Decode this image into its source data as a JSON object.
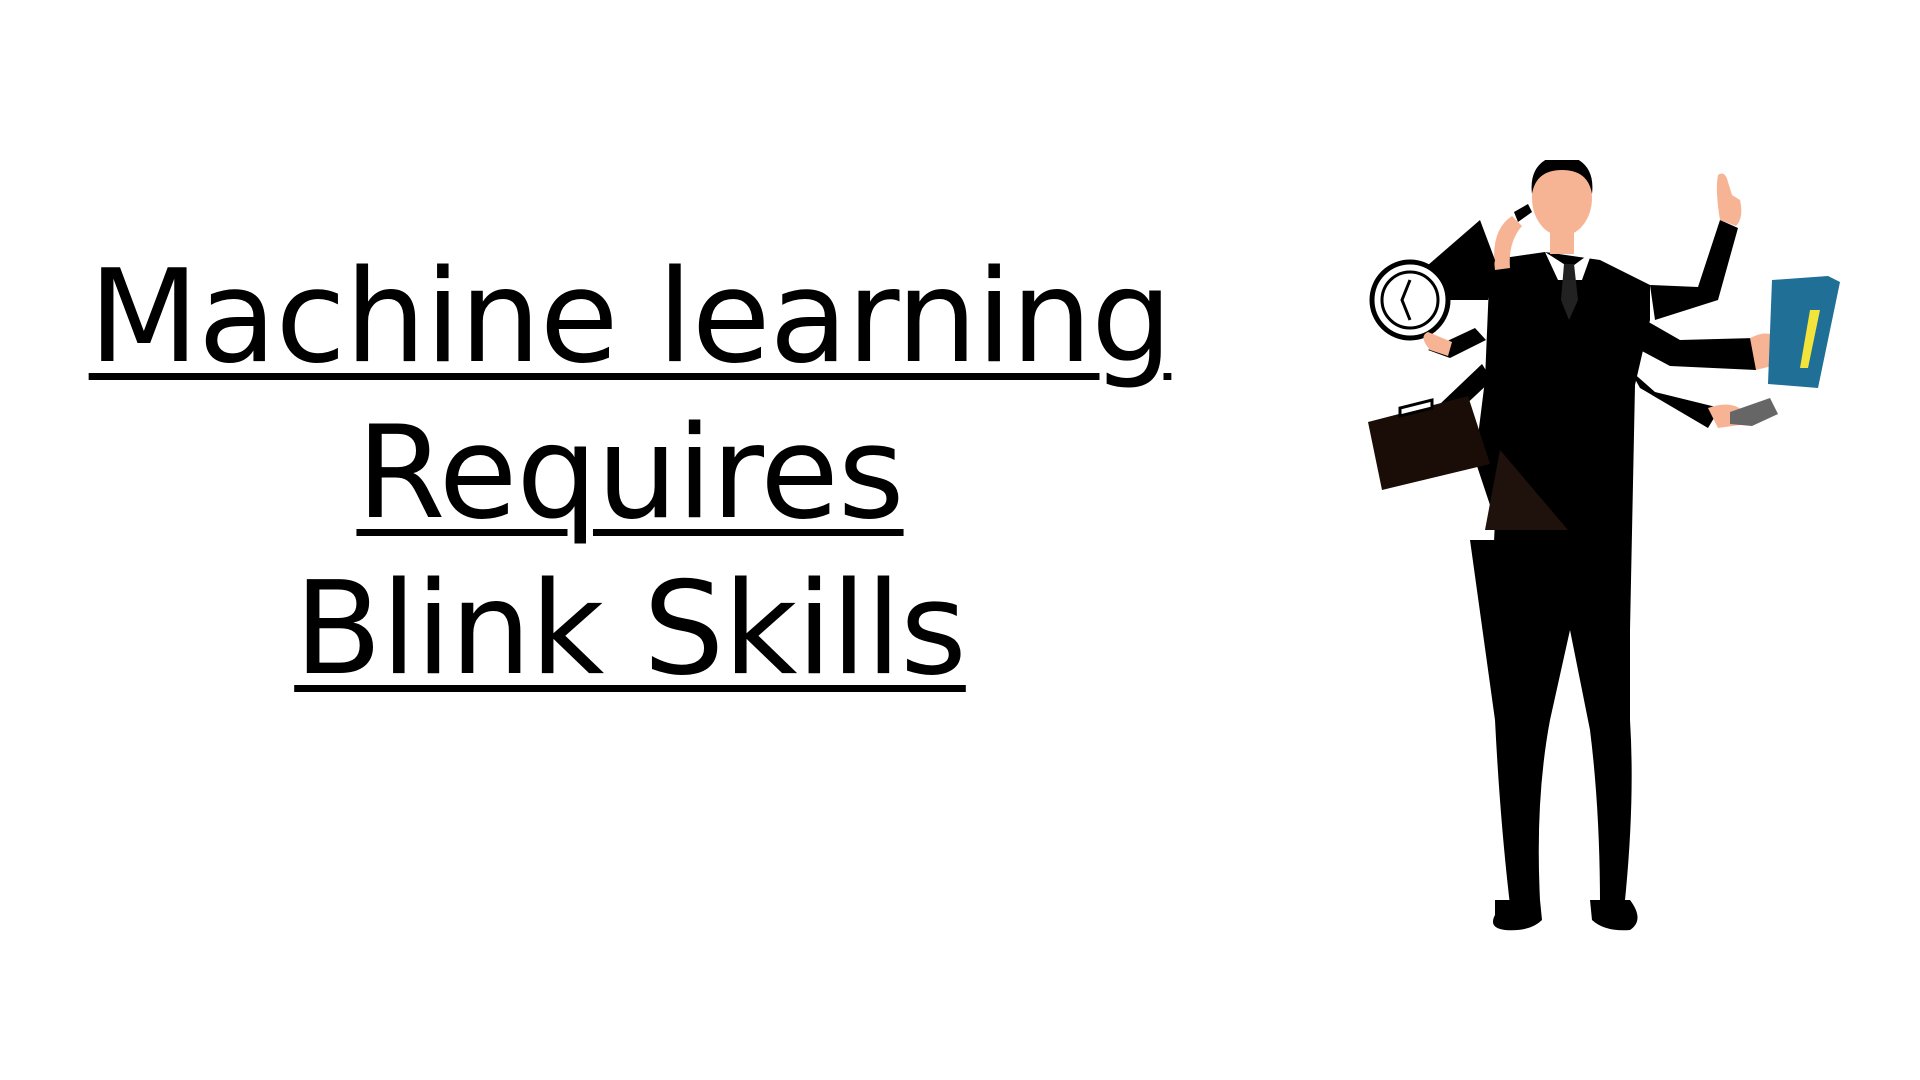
{
  "title": {
    "line1": "Machine learning",
    "line2": "Requires ",
    "line3": "Blink Skills"
  },
  "illustration": {
    "subject": "multitasking-businessman",
    "icons": [
      "clock-icon",
      "briefcase-icon",
      "phone-icon",
      "folder-icon",
      "handset-icon"
    ]
  },
  "colors": {
    "text": "#000000",
    "background": "#ffffff",
    "suit": "#000000",
    "skin": "#f7b495",
    "folder": "#1f6f96",
    "folder_tab": "#f2e43a",
    "briefcase": "#1a0d07"
  }
}
